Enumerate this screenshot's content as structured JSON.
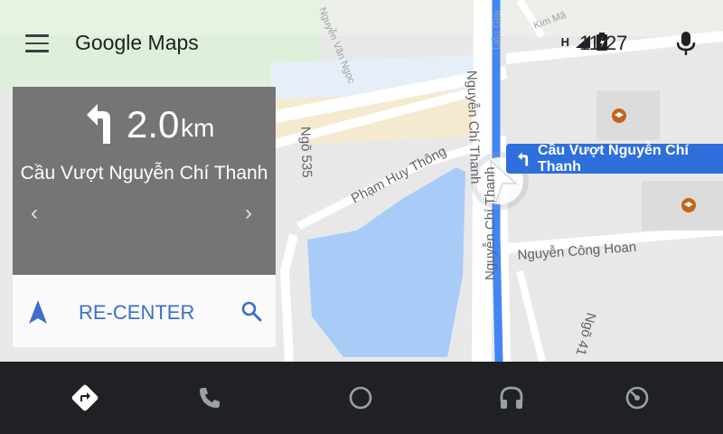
{
  "header": {
    "app_title": "Google Maps",
    "time": "11:27",
    "network_indicator": "H",
    "icons": [
      "menu-icon",
      "signal-icon",
      "battery-icon",
      "microphone-icon"
    ]
  },
  "map": {
    "street_labels": [
      "Nguyễn Văn Ngọc",
      "Ngõ 535",
      "Phạm Huy Thông",
      "Nguyễn Chí Thanh",
      "Nguyễn Công Hoan",
      "Ngõ 41",
      "Liễu Giai",
      "Kim Mã"
    ],
    "route_chip": "Cầu Vượt Nguyễn Chí Thanh",
    "colors": {
      "route": "#4285f4",
      "water": "#a8cbf7",
      "land": "#e8e8e8",
      "road": "#ffffff"
    }
  },
  "navigation": {
    "distance": "2.0",
    "unit": "km",
    "next_street": "Cầu Vượt Nguyễn Chí Thanh",
    "prev_icon": "‹",
    "next_icon": "›"
  },
  "actions": {
    "recenter_label": "RE-CENTER"
  },
  "bottom_nav": {
    "items": [
      "navigation-icon",
      "phone-icon",
      "home-icon",
      "headphones-icon",
      "exit-icon"
    ]
  }
}
